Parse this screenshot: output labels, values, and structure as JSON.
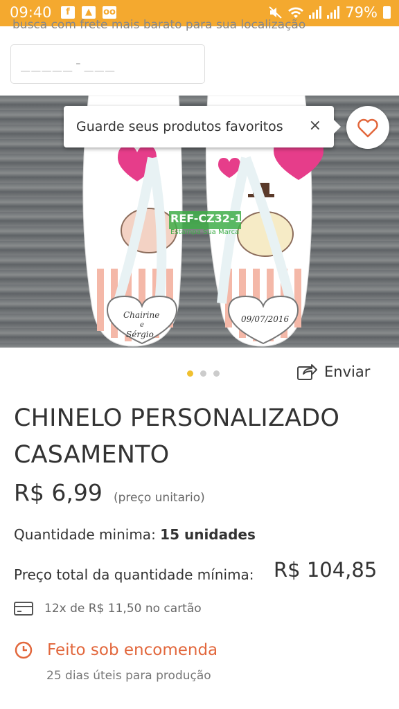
{
  "status_bar": {
    "time": "09:40",
    "battery": "79%",
    "notification_icons": [
      "facebook-icon",
      "image-icon",
      "voicemail-icon"
    ],
    "right_icons": [
      "mute-icon",
      "wifi-icon",
      "signal-icon",
      "signal-icon",
      "battery-icon"
    ],
    "color": "#f4a92f"
  },
  "shipping": {
    "cut_text": "busca com frete mais barato para sua localização",
    "cep_placeholder": "_____-___"
  },
  "tooltip": {
    "text": "Guarde seus produtos favoritos",
    "close": "×"
  },
  "product_image": {
    "ref_label": "REF-CZ32-1",
    "store_label": "Estampa Sua Marca",
    "names": [
      "Chairine",
      "e",
      "Sérgio"
    ],
    "date": "09/07/2016"
  },
  "carousel": {
    "count": 3,
    "active": 0
  },
  "share": {
    "label": "Enviar",
    "icon": "share-icon"
  },
  "product": {
    "title": "CHINELO PERSONALIZADO CASAMENTO",
    "price": "R$ 6,99",
    "price_note": "(preço unitario)",
    "min_qty_label": "Quantidade minima:",
    "min_qty_value": "15 unidades",
    "total_label": "Preço total da quantidade mínima:",
    "total_value": "R$ 104,85",
    "installments": "12x de R$ 11,50 no cartão",
    "made_to_order": "Feito sob encomenda",
    "production_time": "25 dias úteis para produção"
  },
  "colors": {
    "accent": "#e2673c",
    "heart": "#e2673c",
    "dot_active": "#f0c030"
  }
}
